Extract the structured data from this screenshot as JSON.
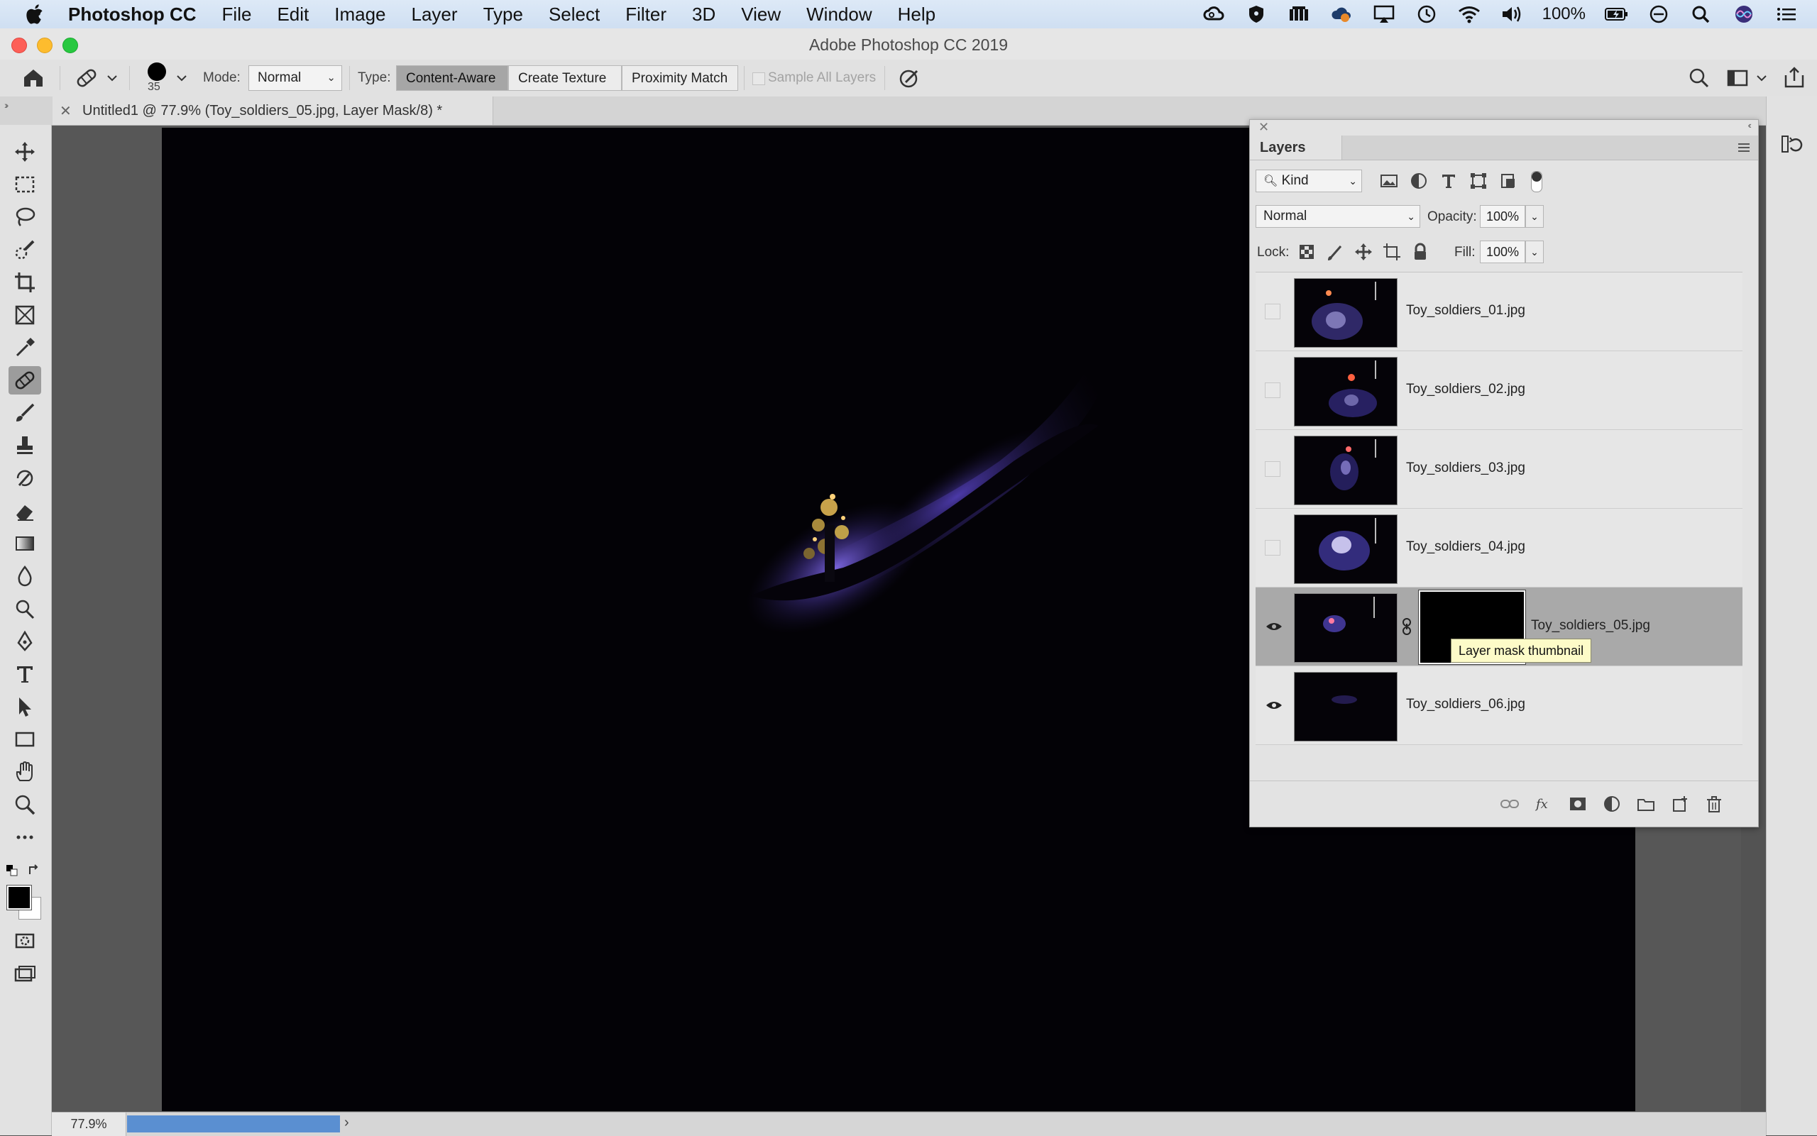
{
  "menubar": {
    "app_name": "Photoshop CC",
    "items": [
      "File",
      "Edit",
      "Image",
      "Layer",
      "Type",
      "Select",
      "Filter",
      "3D",
      "View",
      "Window",
      "Help"
    ],
    "battery": "100%",
    "status_icons": [
      "creative-cloud-icon",
      "vpn-shield-icon",
      "menu-extra-icon",
      "cloud-sync-icon",
      "airplay-icon",
      "time-machine-icon",
      "wifi-icon",
      "volume-icon",
      "battery-icon",
      "do-not-disturb-icon",
      "spotlight-icon",
      "siri-icon",
      "notification-center-icon"
    ]
  },
  "window": {
    "title": "Adobe Photoshop CC 2019"
  },
  "options": {
    "brush_size": "35",
    "mode_label": "Mode:",
    "mode_value": "Normal",
    "type_label": "Type:",
    "type_buttons": [
      "Content-Aware",
      "Create Texture",
      "Proximity Match"
    ],
    "type_active": "Content-Aware",
    "sample_all_layers": "Sample All Layers"
  },
  "document": {
    "tab_title": "Untitled1 @ 77.9% (Toy_soldiers_05.jpg, Layer Mask/8) *",
    "zoom": "77.9%",
    "progress": 1.0
  },
  "layers_panel": {
    "tab": "Layers",
    "kind_filter": "Kind",
    "blend_mode": "Normal",
    "opacity_label": "Opacity:",
    "opacity": "100%",
    "lock_label": "Lock:",
    "fill_label": "Fill:",
    "fill": "100%",
    "layers": [
      {
        "name": "Toy_soldiers_01.jpg",
        "visible": false,
        "selected": false,
        "has_mask": false
      },
      {
        "name": "Toy_soldiers_02.jpg",
        "visible": false,
        "selected": false,
        "has_mask": false
      },
      {
        "name": "Toy_soldiers_03.jpg",
        "visible": false,
        "selected": false,
        "has_mask": false
      },
      {
        "name": "Toy_soldiers_04.jpg",
        "visible": false,
        "selected": false,
        "has_mask": false
      },
      {
        "name": "Toy_soldiers_05.jpg",
        "visible": true,
        "selected": true,
        "has_mask": true
      },
      {
        "name": "Toy_soldiers_06.jpg",
        "visible": true,
        "selected": false,
        "has_mask": false
      }
    ],
    "tooltip": "Layer mask thumbnail"
  },
  "colors": {
    "foreground": "#000000",
    "background": "#ffffff",
    "selection_row": "#a9a9a9",
    "progress_fill": "#5a8fd1"
  }
}
